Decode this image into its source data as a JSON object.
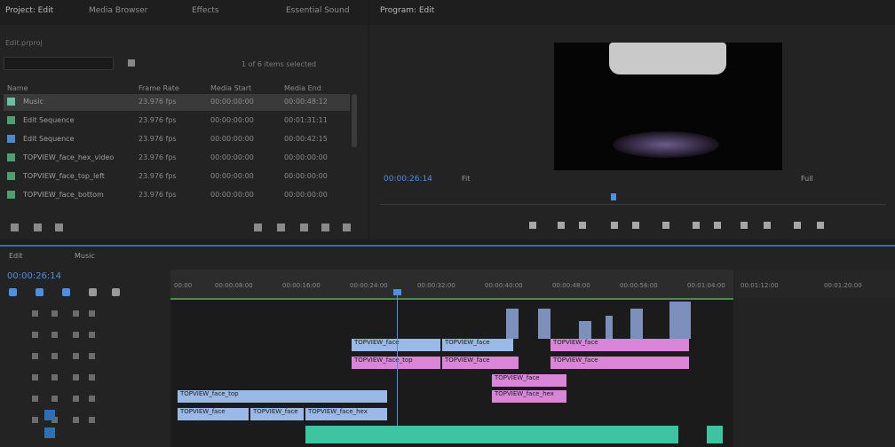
{
  "project": {
    "tabs": [
      "Project: Edit",
      "Media Browser",
      "Effects",
      "Essential Sound"
    ],
    "path": "Edit.prproj",
    "items_count": "1 of 6 items selected",
    "columns": [
      "Name",
      "Frame Rate",
      "Media Start",
      "Media End"
    ],
    "rows": [
      {
        "name": "Music",
        "c1": "23.976 fps",
        "c2": "00:00:00:00",
        "c3": "00:00:48:12",
        "color": "#67c2a0",
        "selected": true
      },
      {
        "name": "Edit Sequence",
        "c1": "23.976 fps",
        "c2": "00:00:00:00",
        "c3": "00:01:31:11",
        "color": "#4da06e",
        "selected": false
      },
      {
        "name": "Edit Sequence",
        "c1": "23.976 fps",
        "c2": "00:00:00:00",
        "c3": "00:00:42:15",
        "color": "#4a88cf",
        "selected": false
      },
      {
        "name": "TOPVIEW_face_hex_video",
        "c1": "23.976 fps",
        "c2": "00:00:00:00",
        "c3": "00:00:00:00",
        "color": "#4da06e",
        "selected": false
      },
      {
        "name": "TOPVIEW_face_top_left",
        "c1": "23.976 fps",
        "c2": "00:00:00:00",
        "c3": "00:00:00:00",
        "color": "#4da06e",
        "selected": false
      },
      {
        "name": "TOPVIEW_face_bottom",
        "c1": "23.976 fps",
        "c2": "00:00:00:00",
        "c3": "00:00:00:00",
        "color": "#4da06e",
        "selected": false
      }
    ]
  },
  "program": {
    "tab": "Program: Edit",
    "timecode": "00:00:26:14",
    "fit": "Fit",
    "fraction": "Full"
  },
  "timeline": {
    "tabs": [
      "Edit",
      "Music"
    ],
    "timecode": "00:00:26:14",
    "ticks": [
      "00:00",
      "00:00:08:00",
      "00:00:16:00",
      "00:00:24:00",
      "00:00:32:00",
      "00:00:40:00",
      "00:00:48:00",
      "00:00:56:00",
      "00:01:04:00"
    ],
    "right_ticks": [
      "00:01:12:00",
      "00:01:20:00"
    ],
    "clips": {
      "c1": "TOPVIEW_face",
      "c2": "TOPVIEW_face",
      "c3": "TOPVIEW_face",
      "c4": "TOPVIEW_face_top",
      "c5": "TOPVIEW_face",
      "c6": "TOPVIEW_face",
      "c7": "TOPVIEW_face",
      "c8": "TOPVIEW_face_top",
      "c9": "TOPVIEW_face_hex",
      "c10": "TOPVIEW_face",
      "c11": "TOPVIEW_face",
      "c12": "TOPVIEW_face_hex"
    }
  },
  "colors": {
    "accent": "#4e8fe0",
    "video_clip": "#9ab9e6",
    "magenta_clip": "#d986d8",
    "audio_clip": "#3ec4a0"
  }
}
